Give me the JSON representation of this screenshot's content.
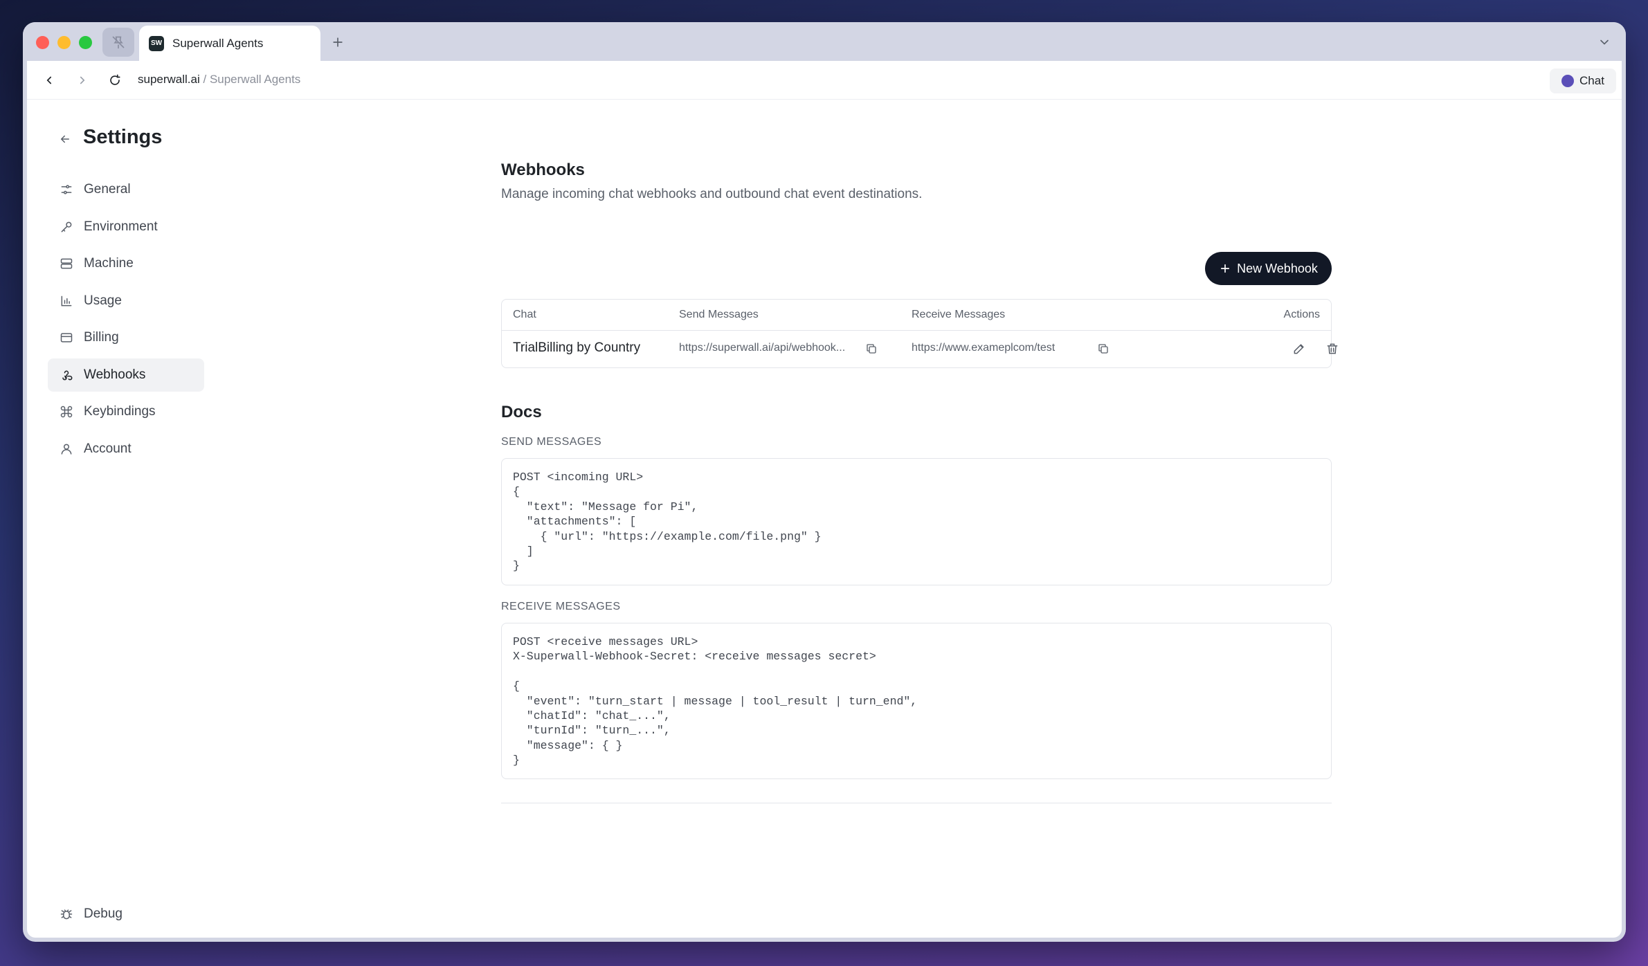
{
  "browser": {
    "tab_title": "Superwall Agents",
    "tab_favicon_text": "SW",
    "url_domain": "superwall.ai",
    "url_separator": " / ",
    "url_path": "Superwall Agents",
    "chat_button_label": "Chat"
  },
  "sidebar": {
    "title": "Settings",
    "items": [
      {
        "label": "General",
        "icon": "sliders-icon"
      },
      {
        "label": "Environment",
        "icon": "key-icon"
      },
      {
        "label": "Machine",
        "icon": "server-icon"
      },
      {
        "label": "Usage",
        "icon": "bar-chart-icon"
      },
      {
        "label": "Billing",
        "icon": "credit-card-icon"
      },
      {
        "label": "Webhooks",
        "icon": "webhook-icon"
      },
      {
        "label": "Keybindings",
        "icon": "command-icon"
      },
      {
        "label": "Account",
        "icon": "user-icon"
      }
    ],
    "active": "Webhooks",
    "debug_label": "Debug"
  },
  "main": {
    "title": "Webhooks",
    "description": "Manage incoming chat webhooks and outbound chat event destinations.",
    "new_button_label": "New Webhook",
    "table": {
      "headers": {
        "chat": "Chat",
        "send": "Send Messages",
        "receive": "Receive Messages",
        "actions": "Actions"
      },
      "rows": [
        {
          "chat": "TrialBilling by Country",
          "send": "https://superwall.ai/api/webhook...",
          "receive": "https://www.exameplcom/test"
        }
      ]
    },
    "docs": {
      "title": "Docs",
      "send_label": "SEND MESSAGES",
      "send_code": "POST <incoming URL>\n{\n  \"text\": \"Message for Pi\",\n  \"attachments\": [\n    { \"url\": \"https://example.com/file.png\" }\n  ]\n}",
      "receive_label": "RECEIVE MESSAGES",
      "receive_code": "POST <receive messages URL>\nX-Superwall-Webhook-Secret: <receive messages secret>\n\n{\n  \"event\": \"turn_start | message | tool_result | turn_end\",\n  \"chatId\": \"chat_...\",\n  \"turnId\": \"turn_...\",\n  \"message\": { }\n}"
    }
  }
}
